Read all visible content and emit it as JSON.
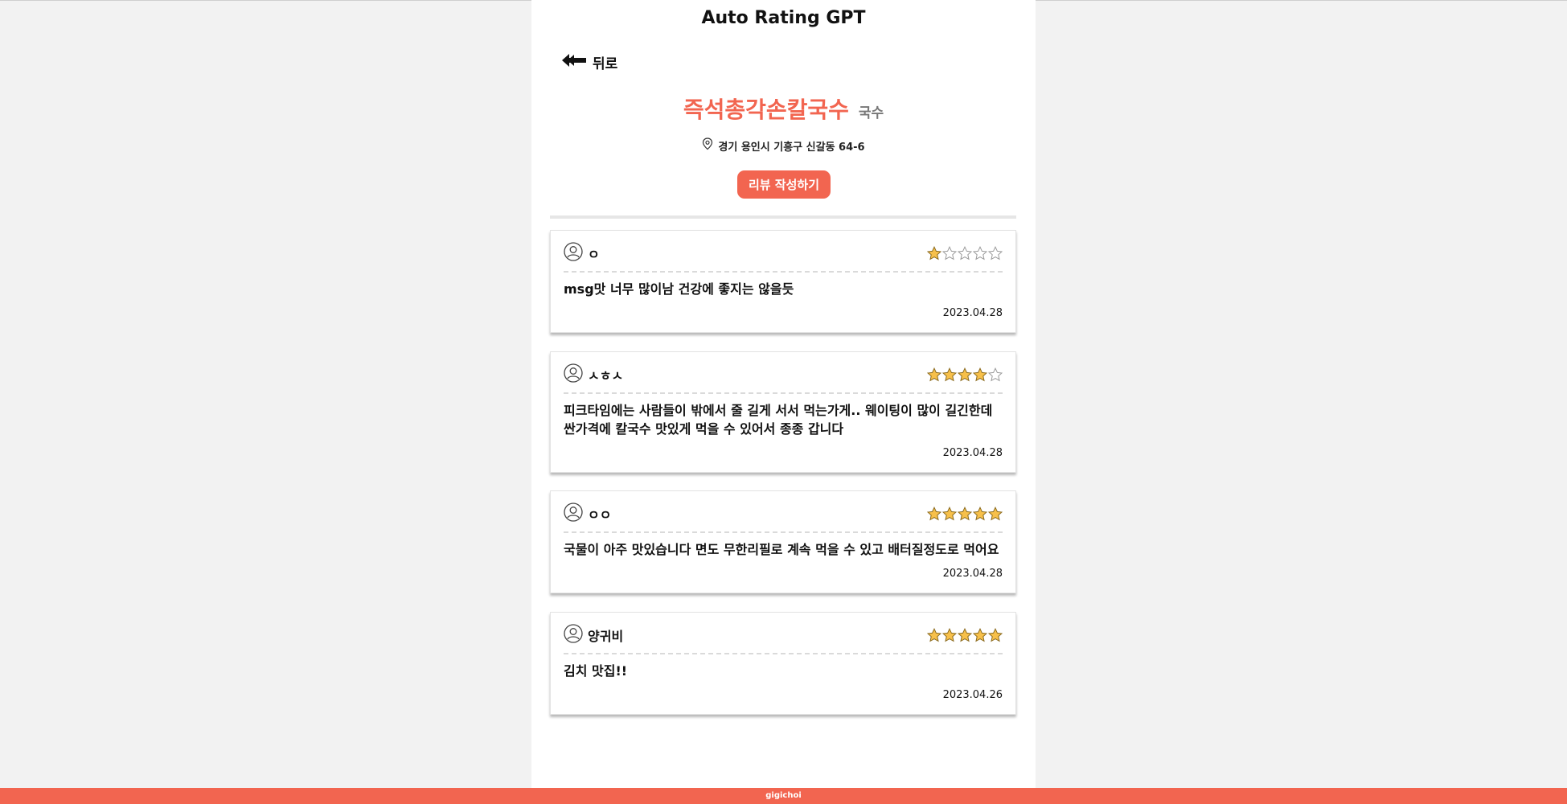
{
  "app": {
    "title": "Auto Rating GPT"
  },
  "nav": {
    "back_label": "뒤로"
  },
  "store": {
    "name": "즉석총각손칼국수",
    "category": "국수",
    "address": "경기 용인시 기흥구 신갈동 64-6"
  },
  "actions": {
    "write_review_label": "리뷰 작성하기"
  },
  "reviews": [
    {
      "user": "ㅇ",
      "rating": 1,
      "text": "msg맛 너무 많이남 건강에 좋지는 않을듯",
      "date": "2023.04.28"
    },
    {
      "user": "ㅅㅎㅅ",
      "rating": 4,
      "text": "피크타임에는 사람들이 밖에서 줄 길게 서서 먹는가게.. 웨이팅이 많이 길긴한데 싼가격에 칼국수 맛있게 먹을 수 있어서 종종 갑니다",
      "date": "2023.04.28"
    },
    {
      "user": "ㅇㅇ",
      "rating": 5,
      "text": "국물이 아주 맛있습니다 면도 무한리필로 계속 먹을 수 있고 배터질정도로 먹어요",
      "date": "2023.04.28"
    },
    {
      "user": "양귀비",
      "rating": 5,
      "text": "김치 맛집!!",
      "date": "2023.04.26"
    }
  ],
  "footer": {
    "text": "gigichoi"
  },
  "colors": {
    "accent": "#f26550",
    "star_fill": "#f7c04a",
    "star_outline": "#999999"
  },
  "icons": {
    "back": "double-left-arrow-icon",
    "location": "map-pin-icon",
    "user": "user-avatar-icon",
    "star": "star-icon"
  }
}
